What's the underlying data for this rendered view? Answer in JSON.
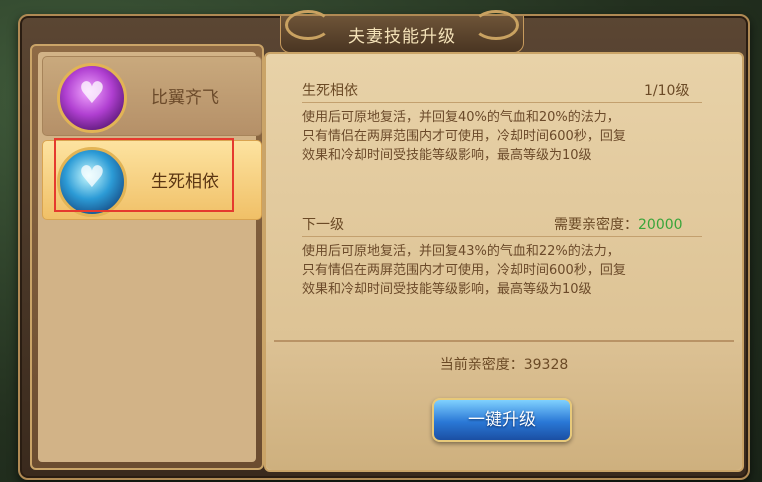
{
  "window": {
    "title": "夫妻技能升级"
  },
  "skills": [
    {
      "name": "比翼齐飞"
    },
    {
      "name": "生死相依"
    }
  ],
  "current": {
    "name": "生死相依",
    "level": "1/10级",
    "desc": [
      "使用后可原地复活，并回复40%的气血和20%的法力，",
      "只有情侣在两屏范围内才可使用，冷却时间600秒，回复",
      "效果和冷却时间受技能等级影响，最高等级为10级"
    ]
  },
  "next": {
    "header": "下一级",
    "req_label": "需要亲密度：",
    "req_value": "20000",
    "desc": [
      "使用后可原地复活，并回复43%的气血和22%的法力，",
      "只有情侣在两屏范围内才可使用，冷却时间600秒，回复",
      "效果和冷却时间受技能等级影响，最高等级为10级"
    ]
  },
  "intimacy": {
    "label": "当前亲密度：",
    "value": "39328"
  },
  "button": {
    "upgrade": "一键升级"
  },
  "icons": {
    "skill_a": "purple-heart-icon",
    "skill_b": "blue-heart-icon"
  },
  "colors": {
    "highlight": "#e53a2e",
    "green": "#3aa53a"
  }
}
